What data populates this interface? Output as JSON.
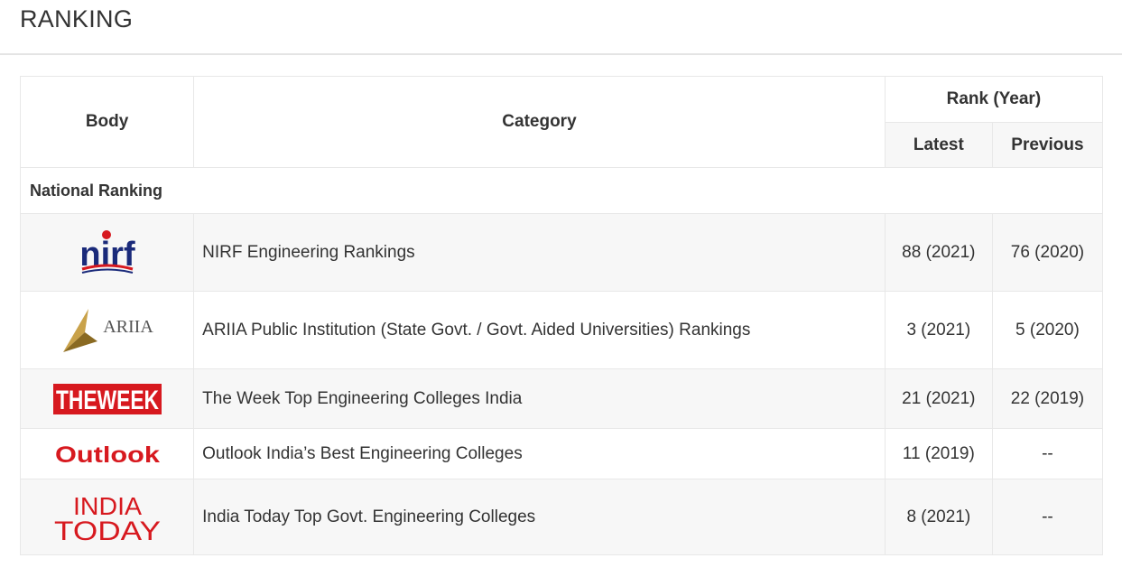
{
  "page": {
    "title": "RANKING"
  },
  "table": {
    "headers": {
      "body": "Body",
      "category": "Category",
      "rank_year": "Rank (Year)",
      "latest": "Latest",
      "previous": "Previous"
    },
    "section": "National Ranking",
    "rows": [
      {
        "logo": "nirf-logo",
        "logo_text": "nirf",
        "category": "NIRF Engineering Rankings",
        "latest": "88 (2021)",
        "previous": "76 (2020)"
      },
      {
        "logo": "ariia-logo",
        "logo_text": "ARIIA",
        "category": "ARIIA Public Institution (State Govt. / Govt. Aided Universities) Rankings",
        "latest": "3 (2021)",
        "previous": "5 (2020)"
      },
      {
        "logo": "the-week-logo",
        "logo_text": "THEWEEK",
        "category": "The Week Top Engineering Colleges India",
        "latest": "21 (2021)",
        "previous": "22 (2019)"
      },
      {
        "logo": "outlook-logo",
        "logo_text": "Outlook",
        "category": "Outlook India’s Best Engineering Colleges",
        "latest": "11 (2019)",
        "previous": "--"
      },
      {
        "logo": "india-today-logo",
        "logo_text": "INDIA TODAY",
        "category": "India Today Top Govt. Engineering Colleges",
        "latest": "8 (2021)",
        "previous": "--"
      }
    ]
  },
  "colors": {
    "border": "#e8e8e8",
    "alt_row": "#f7f7f7",
    "nirf_blue": "#1a2a7a",
    "brand_red": "#d7191f",
    "ariia_gold": "#c9a24a"
  }
}
